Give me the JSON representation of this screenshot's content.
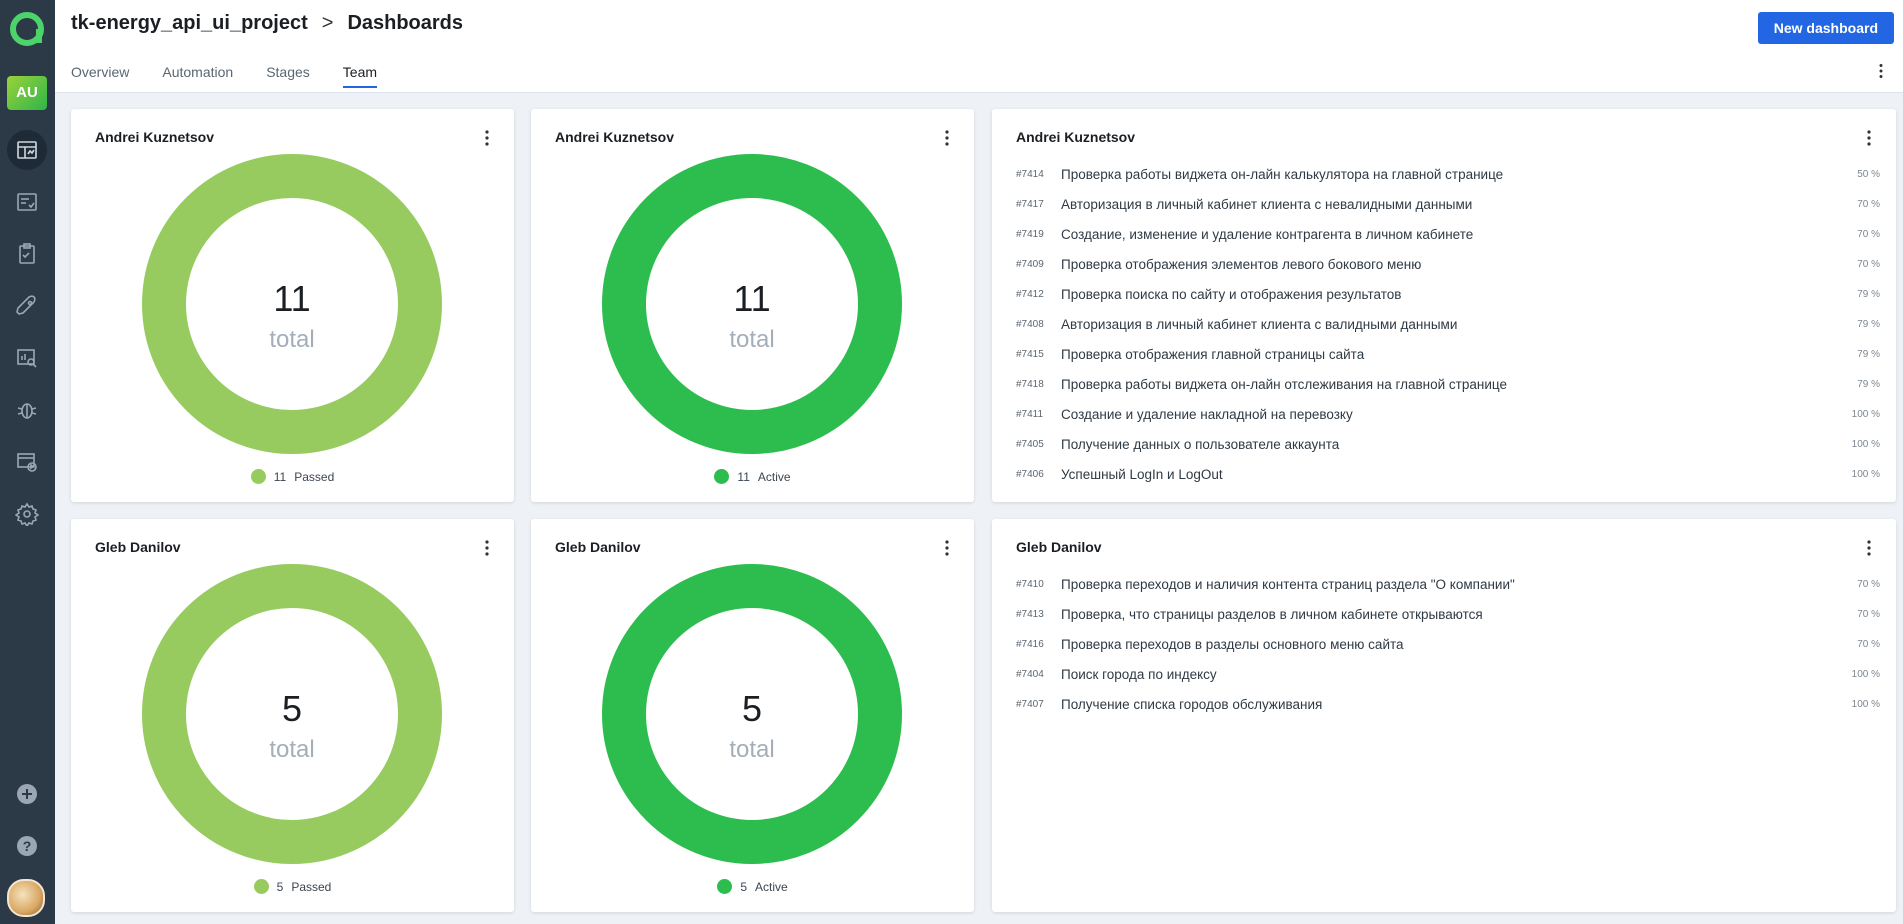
{
  "sidebar": {
    "avatar_initials": "AU",
    "items": [
      {
        "icon": "dashboard-icon",
        "active": true
      },
      {
        "icon": "test-cases-icon"
      },
      {
        "icon": "test-plans-icon"
      },
      {
        "icon": "launches-icon"
      },
      {
        "icon": "analytics-icon"
      },
      {
        "icon": "defects-icon"
      },
      {
        "icon": "jobs-icon"
      },
      {
        "icon": "settings-icon"
      }
    ],
    "bottom": [
      {
        "icon": "add-icon"
      },
      {
        "icon": "help-icon"
      }
    ]
  },
  "header": {
    "project": "tk-energy_api_ui_project",
    "separator": ">",
    "page": "Dashboards",
    "new_button": "New dashboard",
    "tabs": [
      {
        "label": "Overview"
      },
      {
        "label": "Automation"
      },
      {
        "label": "Stages"
      },
      {
        "label": "Team",
        "active": true
      }
    ]
  },
  "colors": {
    "passed": "#97cb5f",
    "active": "#2dbd4f",
    "accent": "#2266e3"
  },
  "widgets": {
    "andrei_passed": {
      "title": "Andrei Kuznetsov",
      "total": "11",
      "total_label": "total",
      "legend_count": "11",
      "legend_label": "Passed"
    },
    "andrei_active": {
      "title": "Andrei Kuznetsov",
      "total": "11",
      "total_label": "total",
      "legend_count": "11",
      "legend_label": "Active"
    },
    "gleb_passed": {
      "title": "Gleb Danilov",
      "total": "5",
      "total_label": "total",
      "legend_count": "5",
      "legend_label": "Passed"
    },
    "gleb_active": {
      "title": "Gleb Danilov",
      "total": "5",
      "total_label": "total",
      "legend_count": "5",
      "legend_label": "Active"
    },
    "andrei_list": {
      "title": "Andrei Kuznetsov",
      "rows": [
        {
          "id": "#7414",
          "name": "Проверка работы виджета он-лайн калькулятора на главной странице",
          "pct": "50 %"
        },
        {
          "id": "#7417",
          "name": "Авторизация в личный кабинет клиента с невалидными данными",
          "pct": "70 %"
        },
        {
          "id": "#7419",
          "name": "Создание, изменение и удаление контрагента в личном кабинете",
          "pct": "70 %"
        },
        {
          "id": "#7409",
          "name": "Проверка отображения элементов левого бокового меню",
          "pct": "70 %"
        },
        {
          "id": "#7412",
          "name": "Проверка поиска по сайту и отображения результатов",
          "pct": "79 %"
        },
        {
          "id": "#7408",
          "name": "Авторизация в личный кабинет клиента с валидными данными",
          "pct": "79 %"
        },
        {
          "id": "#7415",
          "name": "Проверка отображения главной страницы сайта",
          "pct": "79 %"
        },
        {
          "id": "#7418",
          "name": "Проверка работы виджета он-лайн отслеживания на главной странице",
          "pct": "79 %"
        },
        {
          "id": "#7411",
          "name": "Создание и удаление накладной на перевозку",
          "pct": "100 %"
        },
        {
          "id": "#7405",
          "name": "Получение данных о пользователе аккаунта",
          "pct": "100 %"
        },
        {
          "id": "#7406",
          "name": "Успешный LogIn и LogOut",
          "pct": "100 %"
        }
      ]
    },
    "gleb_list": {
      "title": "Gleb Danilov",
      "rows": [
        {
          "id": "#7410",
          "name": "Проверка переходов и наличия контента страниц раздела \"О компании\"",
          "pct": "70 %"
        },
        {
          "id": "#7413",
          "name": "Проверка, что страницы разделов в личном кабинете открываются",
          "pct": "70 %"
        },
        {
          "id": "#7416",
          "name": "Проверка переходов в разделы основного меню сайта",
          "pct": "70 %"
        },
        {
          "id": "#7404",
          "name": "Поиск города по индексу",
          "pct": "100 %"
        },
        {
          "id": "#7407",
          "name": "Получение списка городов обслуживания",
          "pct": "100 %"
        }
      ]
    }
  }
}
